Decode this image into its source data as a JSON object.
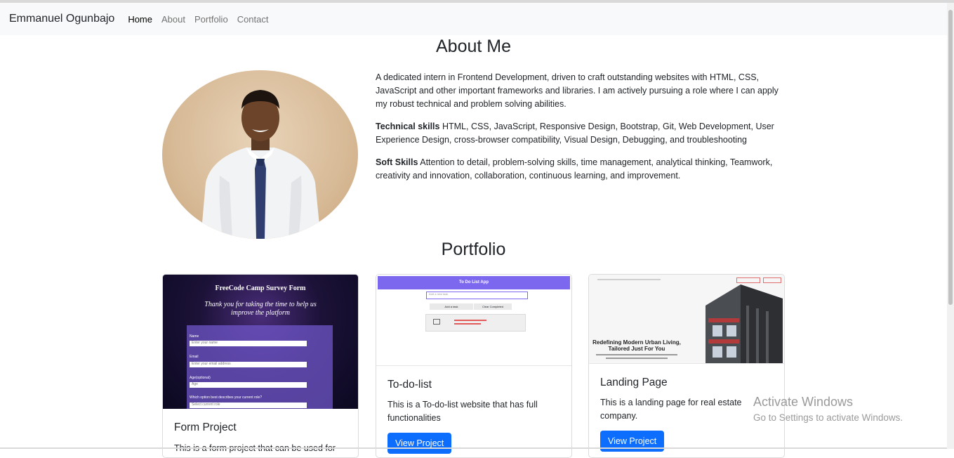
{
  "navbar": {
    "brand": "Emmanuel Ogunbajo",
    "links": [
      "Home",
      "About",
      "Portfolio",
      "Contact"
    ]
  },
  "about": {
    "title": "About Me",
    "intro": "A dedicated intern in Frontend Development, driven to craft outstanding websites with HTML, CSS, JavaScript and other important frameworks and libraries. I am actively pursuing a role where I can apply my robust technical and problem solving abilities.",
    "technical_label": "Technical skills",
    "technical_text": "HTML, CSS, JavaScript, Responsive Design, Bootstrap, Git, Web Development, User Experience Design, cross-browser compatibility, Visual Design, Debugging, and troubleshooting",
    "soft_label": "Soft Skills",
    "soft_text": "Attention to detail, problem-solving skills, time management, analytical thinking, Teamwork, creativity and innovation, collaboration, continuous learning, and improvement."
  },
  "portfolio": {
    "title": "Portfolio",
    "cards": [
      {
        "title": "Form Project",
        "text": "This is a form project that can be used for",
        "thumb": {
          "heading": "FreeCode Camp Survey Form",
          "subtitle1": "Thank you for taking the time to help us",
          "subtitle2": "improve the platform",
          "fields": [
            {
              "label": "Name",
              "placeholder": "Enter your name"
            },
            {
              "label": "Email",
              "placeholder": "Enter your email address"
            },
            {
              "label": "Age(optional)",
              "placeholder": "Age"
            },
            {
              "label": "Which option best describes your current role?",
              "placeholder": "Select current role"
            }
          ]
        }
      },
      {
        "title": "To-do-list",
        "text": "This is a To-do-list website that has full functionalities",
        "button": "View Project",
        "thumb": {
          "header": "To Do List App",
          "input_placeholder": "Add a new task",
          "btn1": "Add a task",
          "btn2": "Clear Completed"
        }
      },
      {
        "title": "Landing Page",
        "text": "This is a landing page for real estate company.",
        "button": "View Project",
        "thumb": {
          "headline1": "Redefining Modern Urban Living,",
          "headline2": "Tailored Just For You"
        }
      }
    ]
  },
  "watermark": {
    "line1": "Activate Windows",
    "line2": "Go to Settings to activate Windows."
  }
}
